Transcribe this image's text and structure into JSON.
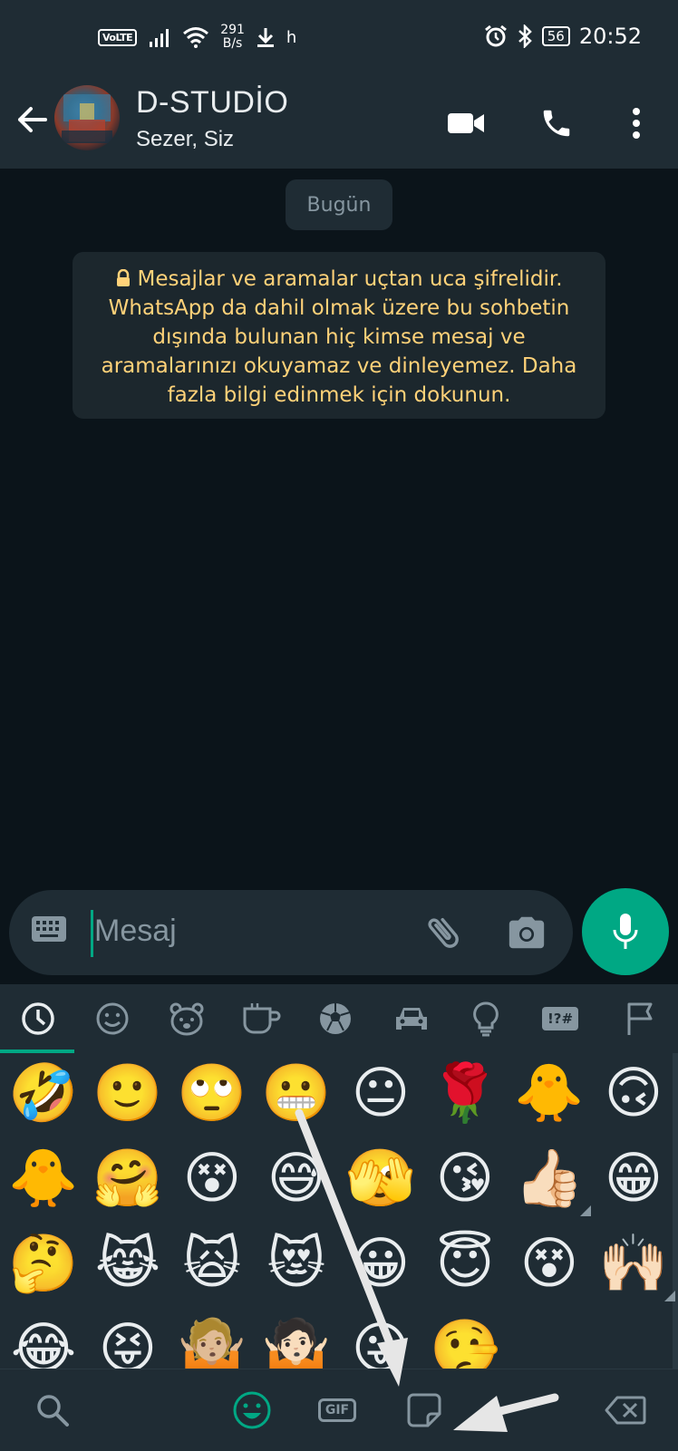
{
  "status_bar": {
    "volte": "VoLTE",
    "net_speed_value": "291",
    "net_speed_unit": "B/s",
    "extra": "h",
    "battery": "56",
    "time": "20:52"
  },
  "header": {
    "title": "D-STUDİO",
    "subtitle": "Sezer, Siz"
  },
  "chat": {
    "date_chip": "Bugün",
    "encryption_notice": "Mesajlar ve aramalar uçtan uca şifrelidir. WhatsApp da dahil olmak üzere bu sohbetin dışında bulunan hiç kimse mesaj ve aramalarınızı okuyamaz ve dinleyemez. Daha fazla bilgi edinmek için dokunun."
  },
  "input": {
    "placeholder": "Mesaj"
  },
  "emoji_panel": {
    "categories": [
      "recent-icon",
      "smiley-icon",
      "animal-icon",
      "food-icon",
      "activity-icon",
      "travel-icon",
      "objects-icon",
      "symbols-icon",
      "flags-icon"
    ],
    "symbols_label": "!?#",
    "rows": [
      [
        "🤣",
        "🙂",
        "🙄",
        "😬",
        "😐",
        "🌹",
        "🐥",
        "🙃"
      ],
      [
        "🐥",
        "🤗",
        "😵",
        "😅",
        "🫣",
        "😘",
        "👍🏻",
        "😁"
      ],
      [
        "🤔",
        "😹",
        "🙀",
        "😻",
        "😀",
        "😇",
        "😵",
        "🙌🏻"
      ],
      [
        "😂",
        "😝",
        "🤷🏼",
        "🤷🏻",
        "😛",
        "🤥"
      ]
    ]
  },
  "bottom_bar": {
    "gif_label": "GIF"
  },
  "colors": {
    "accent": "#00a884",
    "header_bg": "#1f2c34",
    "chat_bg": "#0b141a",
    "notice_text": "#ffd279"
  }
}
